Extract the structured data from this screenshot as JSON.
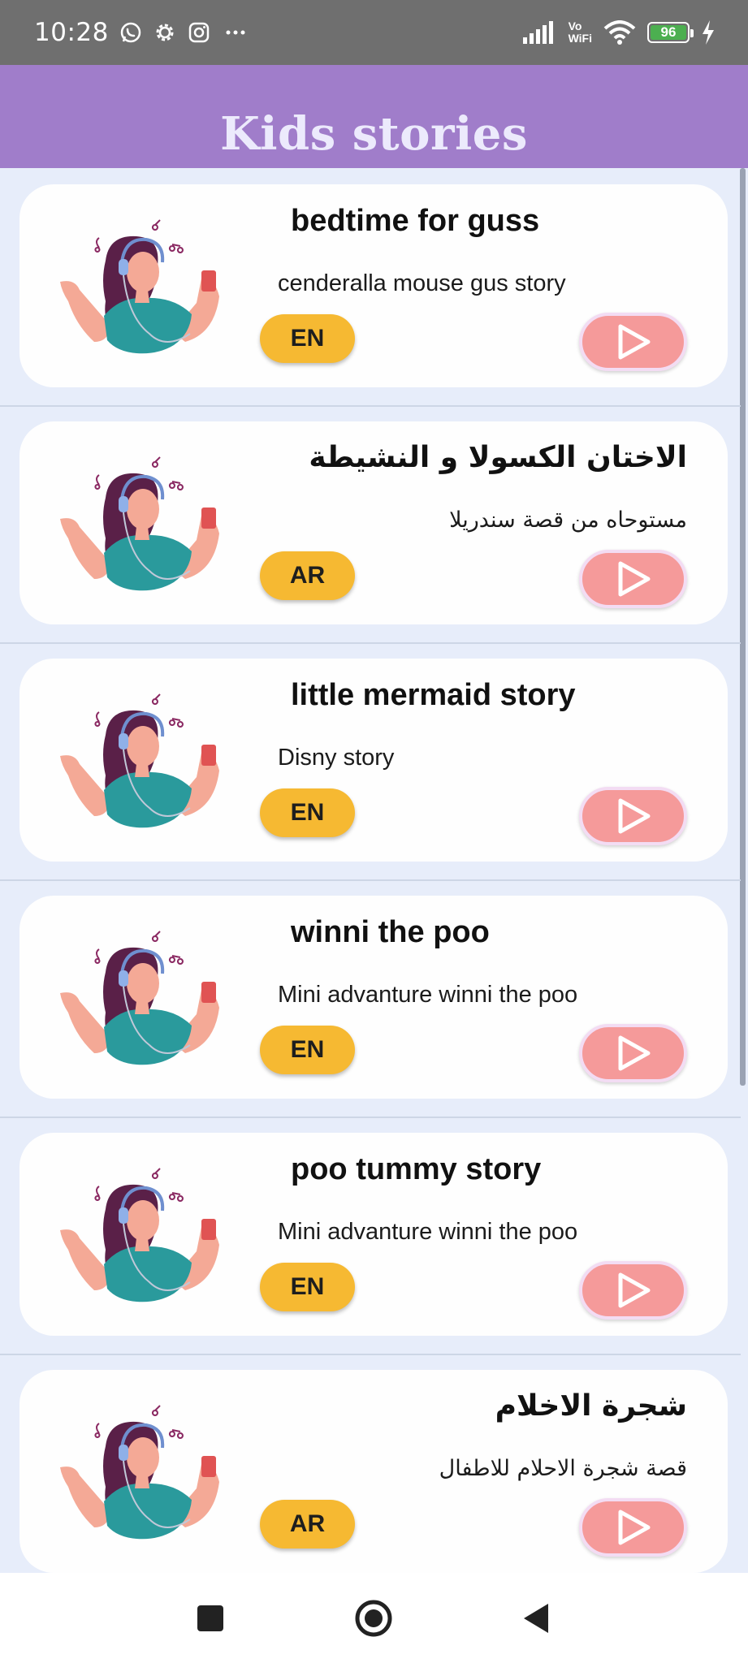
{
  "status_bar": {
    "time": "10:28",
    "network_label_top": "Vo",
    "network_label_bottom": "WiFi",
    "battery_level": "96",
    "left_icons": [
      "whatsapp-icon",
      "settings-gear-icon",
      "instagram-icon",
      "more-dots-icon"
    ],
    "right_icons": [
      "signal-bars-icon",
      "wifi-icon",
      "battery-icon",
      "charging-bolt-icon"
    ]
  },
  "app_bar": {
    "title": "Kids stories"
  },
  "stories": [
    {
      "title": "bedtime for guss",
      "subtitle": "cenderalla mouse gus story",
      "lang": "EN",
      "rtl": false
    },
    {
      "title": "الاختان الكسولا و النشيطة",
      "subtitle": "مستوحاه من قصة سندريلا",
      "lang": "AR",
      "rtl": true
    },
    {
      "title": "little mermaid story",
      "subtitle": "Disny story",
      "lang": "EN",
      "rtl": false
    },
    {
      "title": "winni the poo",
      "subtitle": "Mini advanture winni the poo",
      "lang": "EN",
      "rtl": false
    },
    {
      "title": "poo tummy story",
      "subtitle": "Mini advanture winni the poo",
      "lang": "EN",
      "rtl": false
    },
    {
      "title": "شجرة الاخلام",
      "subtitle": "قصة شجرة الاحلام للاطفال",
      "lang": "AR",
      "rtl": true
    }
  ],
  "nav_bar": {
    "buttons": [
      "recents-square-icon",
      "home-circle-icon",
      "back-triangle-icon"
    ]
  },
  "colors": {
    "status_bar": "#6f6f6f",
    "app_bar": "#a07dca",
    "list_background": "#e7edfa",
    "lang_badge": "#f6b932",
    "play_button": "#f59a9a"
  }
}
